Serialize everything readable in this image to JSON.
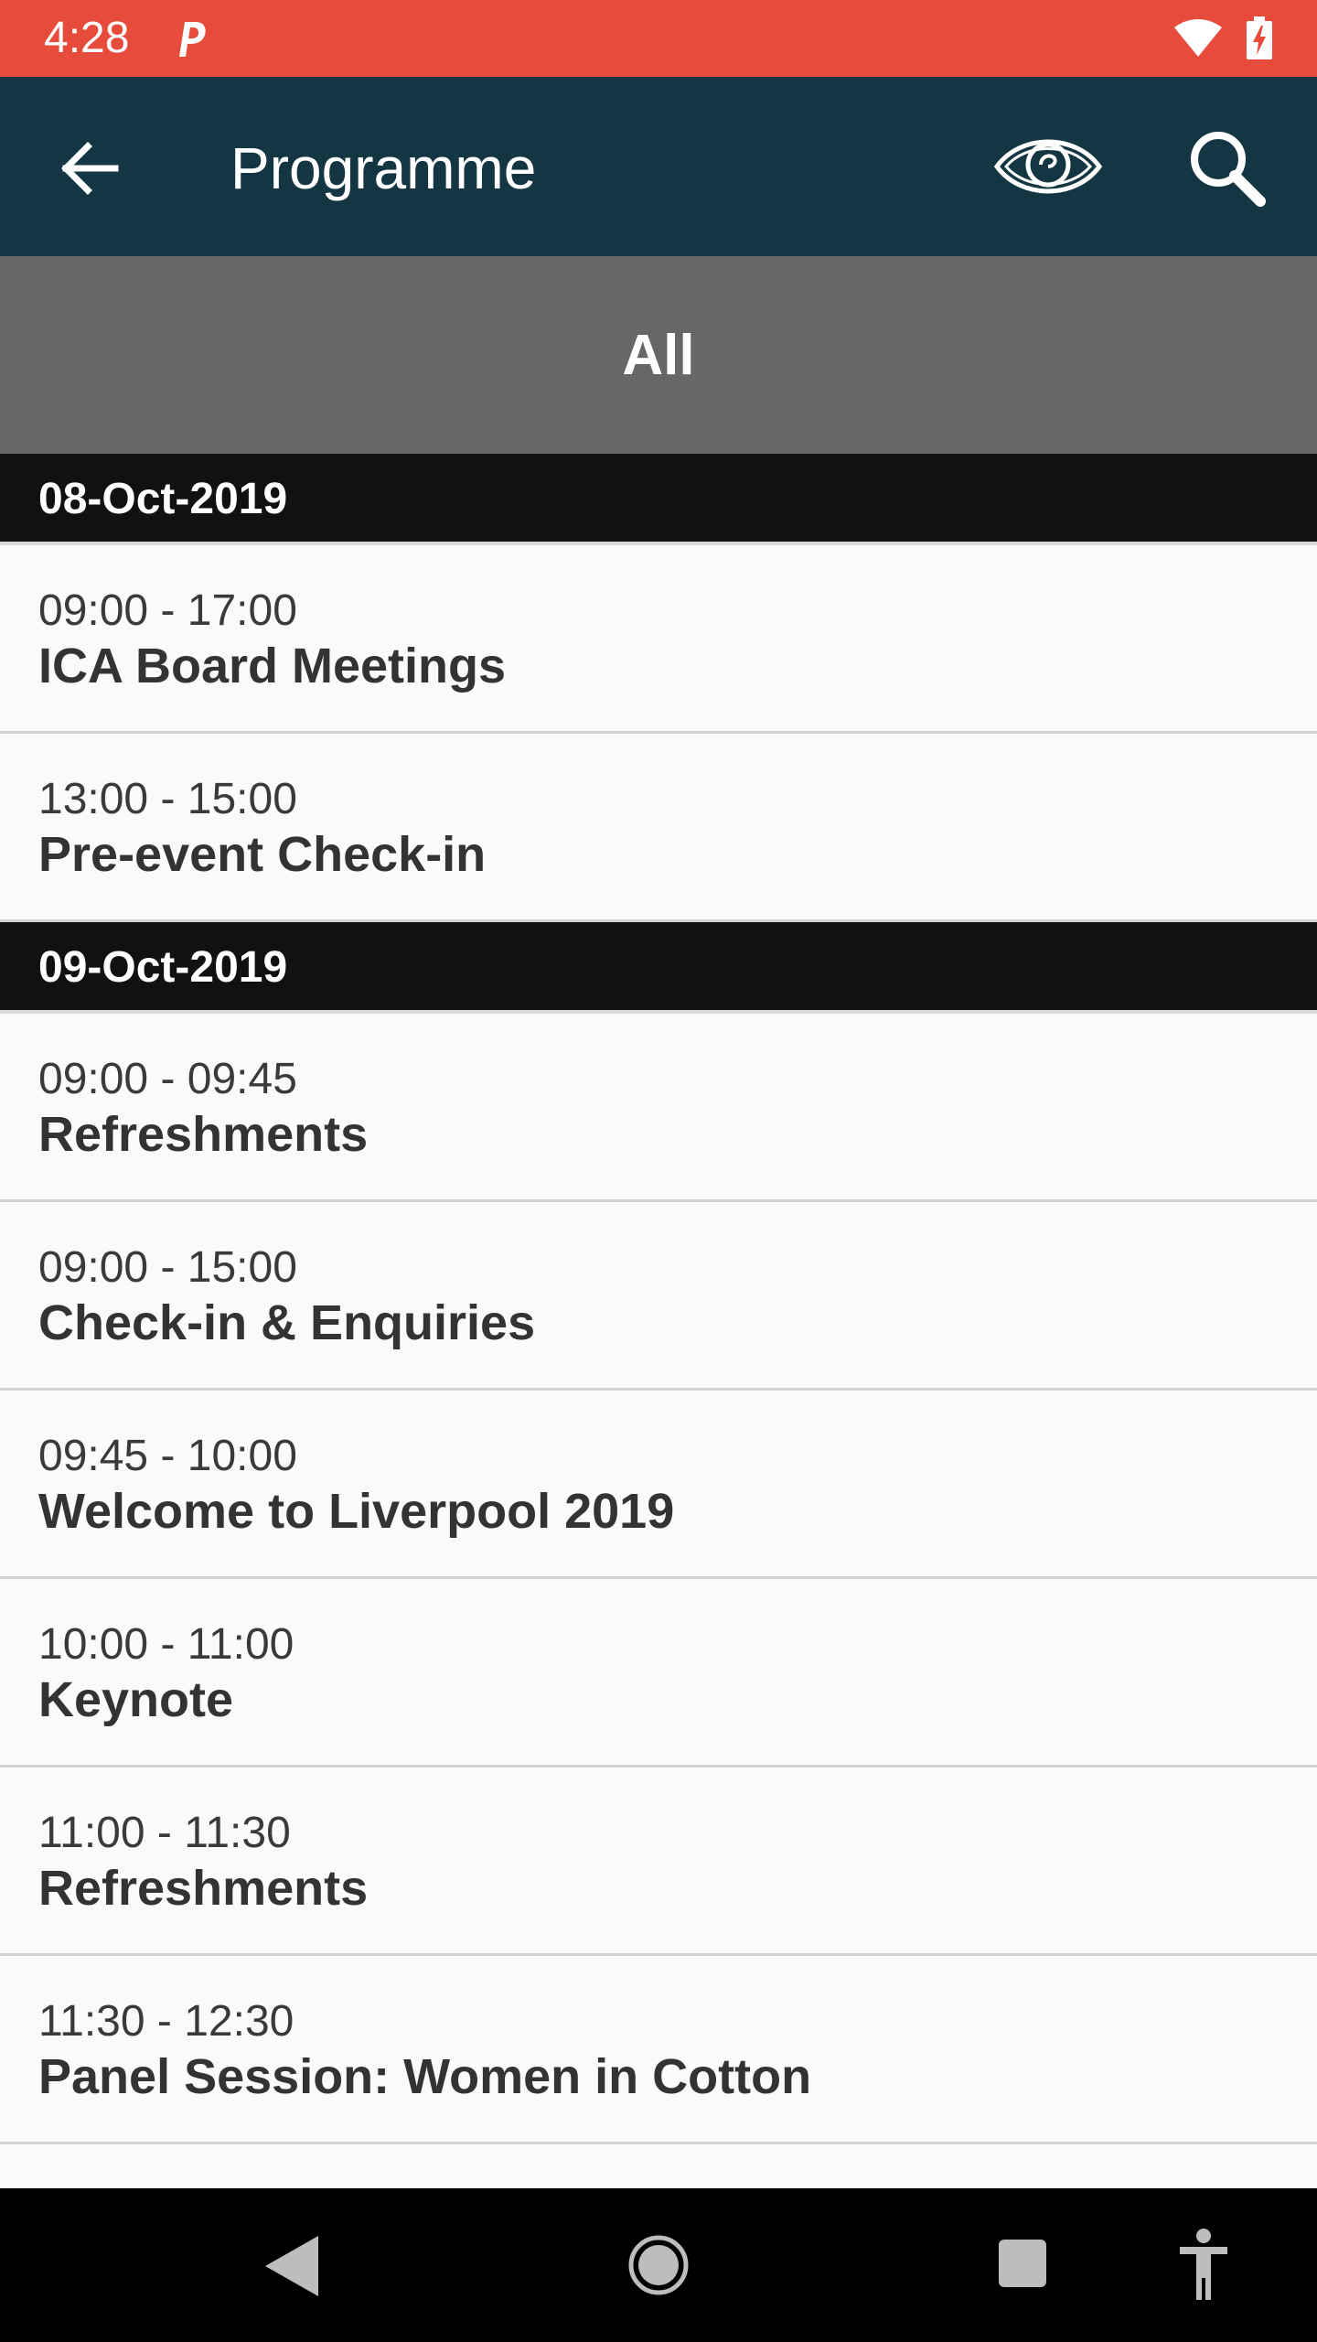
{
  "status_bar": {
    "time": "4:28",
    "background": "#e64b3c"
  },
  "app_bar": {
    "title": "Programme",
    "background": "#143642",
    "icons": [
      "arrow-back-icon",
      "eye-icon",
      "search-icon"
    ]
  },
  "filter": {
    "label": "All"
  },
  "days": [
    {
      "date": "08-Oct-2019",
      "events": [
        {
          "time": "09:00 - 17:00",
          "title": "ICA Board Meetings"
        },
        {
          "time": "13:00 - 15:00",
          "title": "Pre-event Check-in"
        }
      ]
    },
    {
      "date": "09-Oct-2019",
      "events": [
        {
          "time": "09:00 - 09:45",
          "title": "Refreshments"
        },
        {
          "time": "09:00 - 15:00",
          "title": "Check-in & Enquiries"
        },
        {
          "time": "09:45 - 10:00",
          "title": "Welcome to Liverpool 2019"
        },
        {
          "time": "10:00 - 11:00",
          "title": "Keynote"
        },
        {
          "time": "11:00 - 11:30",
          "title": "Refreshments"
        },
        {
          "time": "11:30 - 12:30",
          "title": "Panel Session: Women in Cotton"
        }
      ]
    }
  ],
  "nav_bar": {
    "icons": [
      "nav-back-icon",
      "nav-home-icon",
      "nav-recents-icon",
      "accessibility-icon"
    ]
  }
}
